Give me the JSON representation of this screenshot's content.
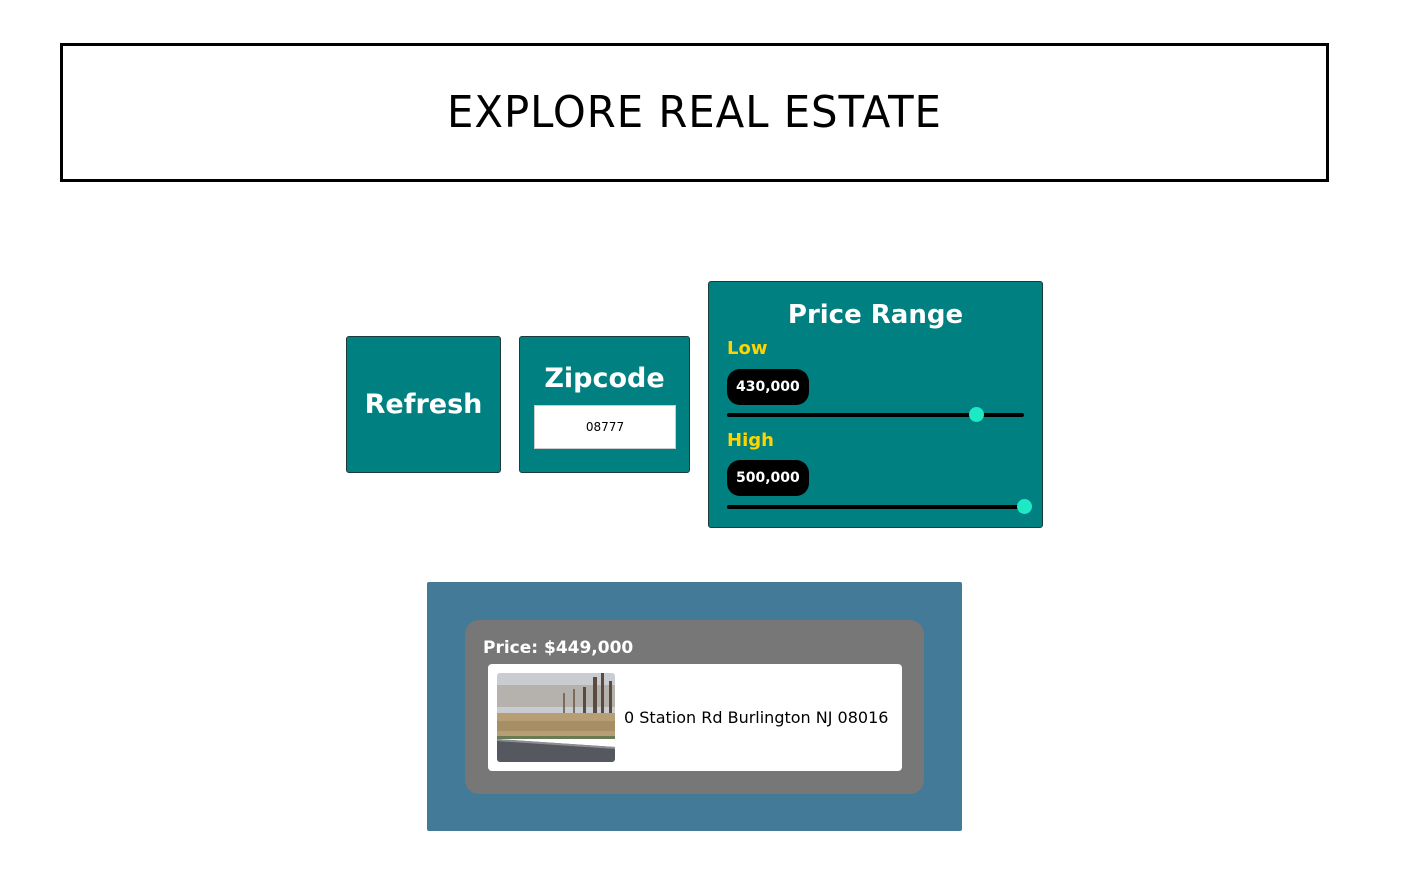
{
  "header": {
    "title": "EXPLORE REAL ESTATE"
  },
  "controls": {
    "refresh_label": "Refresh",
    "zipcode": {
      "label": "Zipcode",
      "value": "08777"
    },
    "price_range": {
      "title": "Price Range",
      "low": {
        "label": "Low",
        "value": "430,000",
        "slider_fraction": 0.84
      },
      "high": {
        "label": "High",
        "value": "500,000",
        "slider_fraction": 1.0
      }
    }
  },
  "results": [
    {
      "price": "Price: $449,000",
      "address": "0 Station Rd Burlington NJ 08016",
      "photo": "empty-lot-roadside-photo"
    }
  ],
  "colors": {
    "panel": "#008080",
    "results_bg": "#427a97",
    "card_bg": "#777777",
    "label_accent": "#ffd400",
    "slider_thumb": "#1de9c4"
  }
}
